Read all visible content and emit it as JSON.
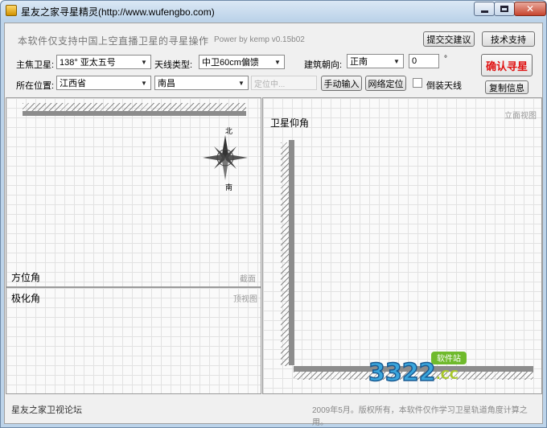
{
  "window": {
    "title": "星友之家寻星精灵(http://www.wufengbo.com)"
  },
  "header": {
    "note": "本软件仅支持中国上空直播卫星的寻星操作",
    "version": "Power by kemp  v0.15b02",
    "feedback_button": "提交交建议",
    "support_button": "技术支持",
    "confirm_button": "确认寻星",
    "copy_button": "复制信息"
  },
  "form": {
    "satellite_label": "主焦卫星:",
    "satellite_value": "138°   亚太五号",
    "antenna_label": "天线类型:",
    "antenna_value": "中卫60cm偏馈",
    "orientation_label": "建筑朝向:",
    "orientation_value": "正南",
    "angle_value": "0",
    "angle_unit": "°",
    "location_label": "所在位置:",
    "province_value": "江西省",
    "city_value": "南昌",
    "locating_placeholder": "定位中...",
    "manual_input_button": "手动输入",
    "network_locate_button": "网络定位",
    "inverted_label": "倒装天线"
  },
  "panels": {
    "azimuth": {
      "title": "方位角",
      "tag": "截面",
      "compass_north": "北",
      "compass_south": "南"
    },
    "polarization": {
      "title": "极化角",
      "tag": "顶视图"
    },
    "elevation": {
      "title": "卫星仰角",
      "tag": "立面视图"
    }
  },
  "status": {
    "left": "星友之家卫视论坛",
    "right": "2009年5月。版权所有，本软件仅作学习卫星轨道角度计算之用。"
  },
  "watermark": {
    "text": "3322",
    "suffix": ".CC",
    "badge": "软件站"
  },
  "icons": [
    "app-icon",
    "minimize-icon",
    "maximize-icon",
    "close-icon",
    "chevron-down-icon",
    "compass-icon"
  ]
}
